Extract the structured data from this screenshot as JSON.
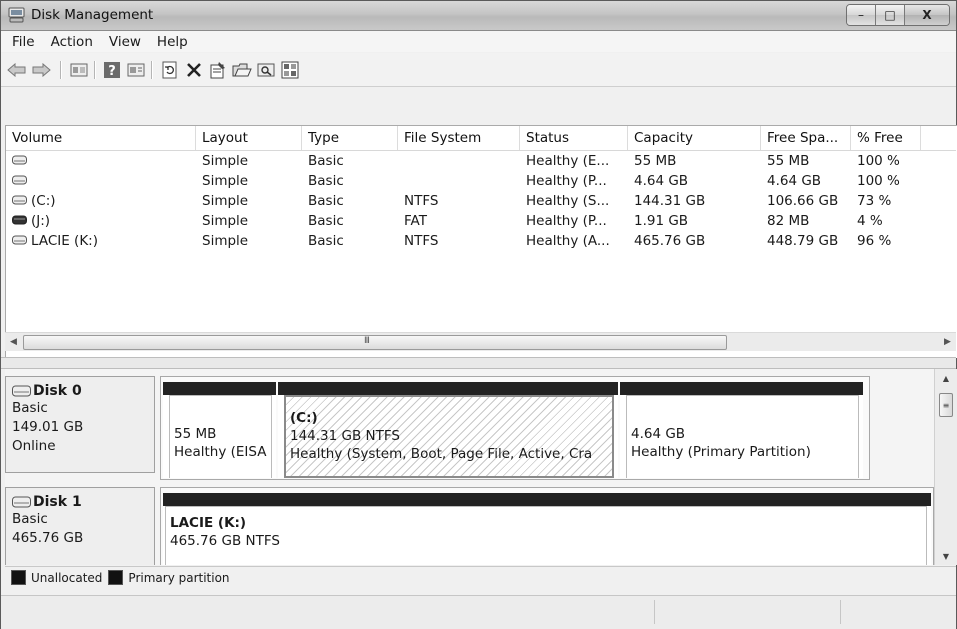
{
  "window": {
    "title": "Disk Management",
    "controls": {
      "minimize": "–",
      "maximize": "□",
      "close": "X"
    }
  },
  "menu": [
    "File",
    "Action",
    "View",
    "Help"
  ],
  "toolbar": [
    "back-icon",
    "forward-icon",
    "properties-view-icon",
    "help-icon",
    "list-view-icon",
    "refresh-icon",
    "delete-icon",
    "properties-icon",
    "open-folder-icon",
    "explore-icon",
    "settings-icon"
  ],
  "volume_list": {
    "columns": [
      "Volume",
      "Layout",
      "Type",
      "File System",
      "Status",
      "Capacity",
      "Free Spa...",
      "% Free"
    ],
    "rows": [
      {
        "volume": "",
        "layout": "Simple",
        "type": "Basic",
        "fs": "",
        "status": "Healthy (E...",
        "capacity": "55 MB",
        "free": "55 MB",
        "pct": "100 %",
        "icon": "drive-icon"
      },
      {
        "volume": "",
        "layout": "Simple",
        "type": "Basic",
        "fs": "",
        "status": "Healthy (P...",
        "capacity": "4.64 GB",
        "free": "4.64 GB",
        "pct": "100 %",
        "icon": "drive-icon"
      },
      {
        "volume": "(C:)",
        "layout": "Simple",
        "type": "Basic",
        "fs": "NTFS",
        "status": "Healthy (S...",
        "capacity": "144.31 GB",
        "free": "106.66 GB",
        "pct": "73 %",
        "icon": "drive-icon"
      },
      {
        "volume": "(J:)",
        "layout": "Simple",
        "type": "Basic",
        "fs": "FAT",
        "status": "Healthy (P...",
        "capacity": "1.91 GB",
        "free": "82 MB",
        "pct": "4 %",
        "icon": "removable-drive-icon"
      },
      {
        "volume": "LACIE (K:)",
        "layout": "Simple",
        "type": "Basic",
        "fs": "NTFS",
        "status": "Healthy (A...",
        "capacity": "465.76 GB",
        "free": "448.79 GB",
        "pct": "96 %",
        "icon": "drive-icon"
      }
    ]
  },
  "disks": [
    {
      "name": "Disk 0",
      "type": "Basic",
      "size": "149.01 GB",
      "state": "Online",
      "partitions": [
        {
          "label": "",
          "size": "55 MB",
          "status": "Healthy (EISA"
        },
        {
          "label": "(C:)",
          "size": "144.31 GB NTFS",
          "status": "Healthy (System, Boot, Page File, Active, Cra"
        },
        {
          "label": "",
          "size": "4.64 GB",
          "status": "Healthy (Primary Partition)"
        }
      ]
    },
    {
      "name": "Disk 1",
      "type": "Basic",
      "size": "465.76 GB",
      "state": "",
      "partitions": [
        {
          "label": "LACIE  (K:)",
          "size": "465.76 GB NTFS",
          "status": ""
        }
      ]
    }
  ],
  "legend": [
    {
      "label": "Unallocated",
      "color": "#111111"
    },
    {
      "label": "Primary partition",
      "color": "#1a1a1a"
    }
  ],
  "hscroll_grip": "III",
  "colors": {
    "partition_bar": "#222222",
    "window_bg": "#f0f0f0"
  }
}
